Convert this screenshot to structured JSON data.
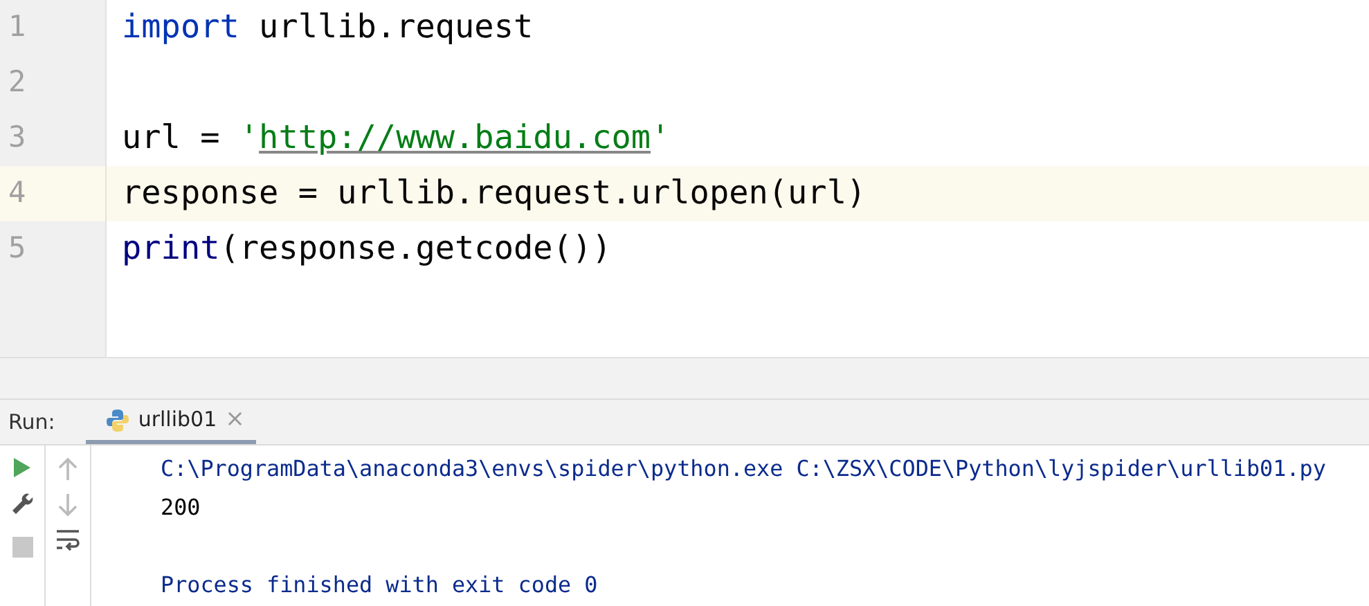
{
  "editor": {
    "lines": [
      {
        "number": "1",
        "current": false,
        "tokens": [
          {
            "kind": "keyword",
            "text": "import"
          },
          {
            "kind": "plain",
            "text": " urllib.request"
          }
        ]
      },
      {
        "number": "2",
        "current": false
      },
      {
        "number": "3",
        "current": false,
        "tokens": [
          {
            "kind": "plain",
            "text": "url = "
          },
          {
            "kind": "string",
            "text": "'"
          },
          {
            "kind": "url",
            "text": "http://www.baidu.com"
          },
          {
            "kind": "string",
            "text": "'"
          }
        ]
      },
      {
        "number": "4",
        "current": true,
        "tokens": [
          {
            "kind": "plain",
            "text": "response = urllib.request.urlopen(url)"
          }
        ]
      },
      {
        "number": "5",
        "current": false,
        "tokens": [
          {
            "kind": "builtin",
            "text": "print"
          },
          {
            "kind": "plain",
            "text": "(response.getcode())"
          }
        ]
      }
    ]
  },
  "run_panel": {
    "label": "Run:",
    "tabs": [
      {
        "label": "urllib01",
        "selected": true,
        "close": "×"
      }
    ],
    "console": [
      {
        "kind": "system",
        "text": "C:\\ProgramData\\anaconda3\\envs\\spider\\python.exe C:\\ZSX\\CODE\\Python\\lyjspider\\urllib01.py"
      },
      {
        "kind": "stdout",
        "text": "200"
      },
      {
        "kind": "blank"
      },
      {
        "kind": "system",
        "text": "Process finished with exit code 0"
      }
    ]
  }
}
